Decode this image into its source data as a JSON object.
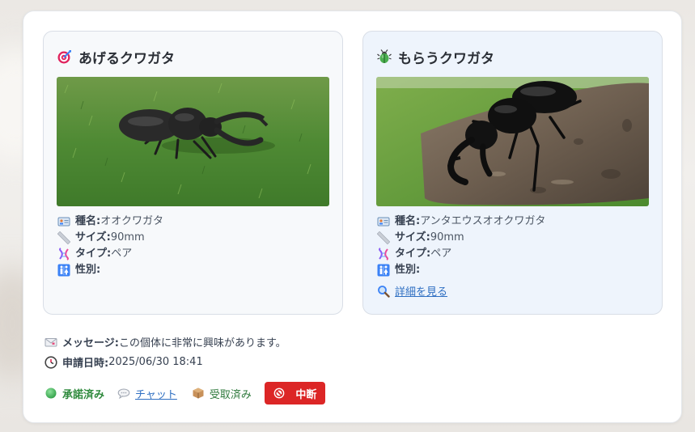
{
  "give": {
    "title": "あげるクワガタ",
    "title_icon": "target-icon",
    "details": [
      {
        "icon": "id-card-icon",
        "label": "種名:",
        "value": " オオクワガタ"
      },
      {
        "icon": "ruler-icon",
        "label": "サイズ:",
        "value": " 90mm"
      },
      {
        "icon": "dna-icon",
        "label": "タイプ:",
        "value": " ペア"
      },
      {
        "icon": "restroom-icon",
        "label": "性別:",
        "value": ""
      }
    ]
  },
  "get": {
    "title": "もらうクワガタ",
    "title_icon": "beetle-icon",
    "details": [
      {
        "icon": "id-card-icon",
        "label": "種名:",
        "value": " アンタエウスオオクワガタ"
      },
      {
        "icon": "ruler-icon",
        "label": "サイズ:",
        "value": " 90mm"
      },
      {
        "icon": "dna-icon",
        "label": "タイプ:",
        "value": " ペア"
      },
      {
        "icon": "restroom-icon",
        "label": "性別:",
        "value": ""
      }
    ],
    "detail_link": "詳細を見る"
  },
  "message": {
    "label": "メッセージ:",
    "value": " この個体に非常に興味があります。"
  },
  "applied": {
    "label": "申請日時:",
    "value": " 2025/06/30 18:41"
  },
  "actions": {
    "status": "承諾済み",
    "chat": "チャット",
    "received": "受取済み",
    "stop": "中断"
  },
  "colors": {
    "accent_link": "#2f6fc2",
    "status_green": "#2f8a3d",
    "danger": "#dc2626"
  }
}
